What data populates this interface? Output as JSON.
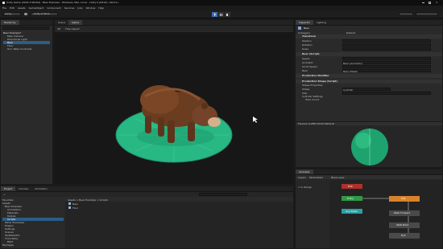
{
  "window": {
    "title": "Unity Game (2022.3.Win64) - Bear Example - Windows, Mac, Linux - Unity 6 (DX12) <DX11>"
  },
  "menu": [
    "File",
    "Edit",
    "Assets",
    "GameObject",
    "Component",
    "Services",
    "Jobs",
    "Window",
    "Help"
  ],
  "toolbar": {
    "account": "Leroy ",
    "cloud_label": "Unity 6 Store"
  },
  "hierarchy": {
    "tab": "Hierarchy",
    "items": [
      "Bear Example*",
      "Main Camera",
      "Directional Light",
      "Bear",
      "Floor",
      "Turn Table Controller"
    ]
  },
  "scene_tabs": [
    "Scene",
    "Game"
  ],
  "scene": {
    "bar_items": [
      "2D",
      "Free Aspect"
    ],
    "colors": {
      "bg": "#171717",
      "disc": "#27b884",
      "disc_dark": "#1f8f66"
    }
  },
  "inspector": {
    "tabs": [
      "Inspector",
      "Lighting"
    ],
    "object_name": "Bear",
    "tag": "Untagged",
    "layer": "Default",
    "transform_header": "Transform",
    "transform_rows": [
      "Position",
      "Rotation",
      "Scale"
    ],
    "component_header": "Bear (Script)",
    "component_rows": [
      "Speed",
      "Animator",
      "Scroll Speed",
      "Bear"
    ],
    "animator_value": "Bear (Animator)",
    "bear_value": "Bear (Mesh)",
    "section2_header": "Production Modifier",
    "section3_header": "Production Shape (Script)",
    "section3_rows": [
      "Shape Properties",
      "Shape",
      "Size"
    ],
    "shape_value": "Cylinder",
    "section4_header": "Cylinder Settings",
    "section4_rows": [
      "Tube Count"
    ],
    "preview_label": "Preview (1280x1024) Material",
    "accent": "#4a7ab8"
  },
  "project": {
    "tabs": [
      "Project",
      "Console",
      "Animation"
    ],
    "create_label": "+",
    "breadcrumb": "Assets > Bear Example > Scripts",
    "tree": [
      "Favorites",
      "Assets",
      "Bear Example",
      "Animations",
      "Materials",
      "Models",
      "Scripts",
      "Other Examples",
      "Plugins",
      "Settings",
      "Scenes",
      "TextMeshPro",
      "Third Party",
      "BOLT",
      "Packages"
    ],
    "files": [
      "Bear",
      "Floor"
    ]
  },
  "animator": {
    "tabs": [
      "Animator"
    ],
    "sub_tabs": [
      "Layers",
      "Parameters"
    ],
    "base_layer": "Base Layer",
    "row_label": "= In Range",
    "nodes": [
      {
        "label": "Any State",
        "color": "#2aa1a3"
      },
      {
        "label": "Entry",
        "color": "#2f9a46"
      },
      {
        "label": "Exit",
        "color": "#b0302b"
      },
      {
        "label": "Idle",
        "color": "#d8822c"
      },
      {
        "label": "Walk Forward",
        "color": "#4a4a4a"
      },
      {
        "label": "Walk Back",
        "color": "#4a4a4a"
      },
      {
        "label": "Roll",
        "color": "#4a4a4a"
      }
    ]
  },
  "statusbar": {
    "text": ""
  }
}
